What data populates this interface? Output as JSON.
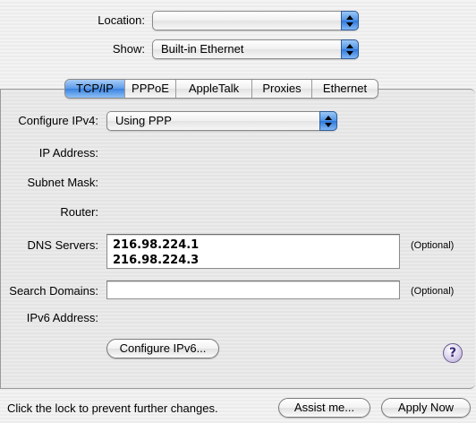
{
  "location": {
    "label": "Location:",
    "value": ""
  },
  "show": {
    "label": "Show:",
    "value": "Built-in Ethernet"
  },
  "tabs": [
    {
      "label": "TCP/IP",
      "active": true
    },
    {
      "label": "PPPoE",
      "active": false
    },
    {
      "label": "AppleTalk",
      "active": false
    },
    {
      "label": "Proxies",
      "active": false
    },
    {
      "label": "Ethernet",
      "active": false
    }
  ],
  "configure_ipv4": {
    "label": "Configure IPv4:",
    "value": "Using PPP"
  },
  "ip_address": {
    "label": "IP Address:"
  },
  "subnet_mask": {
    "label": "Subnet Mask:"
  },
  "router": {
    "label": "Router:"
  },
  "dns_servers": {
    "label": "DNS Servers:",
    "values": [
      "216.98.224.1",
      "216.98.224.3"
    ],
    "optional": "(Optional)"
  },
  "search_domains": {
    "label": "Search Domains:",
    "value": "",
    "optional": "(Optional)"
  },
  "ipv6_address": {
    "label": "IPv6 Address:"
  },
  "configure_ipv6_button": "Configure IPv6...",
  "help_button": "?",
  "footer": {
    "lock_text": "Click the lock to prevent further changes.",
    "assist_button": "Assist me...",
    "apply_button": "Apply Now"
  },
  "colors": {
    "accent_blue": "#3a82e0",
    "window_bg": "#ececec"
  }
}
